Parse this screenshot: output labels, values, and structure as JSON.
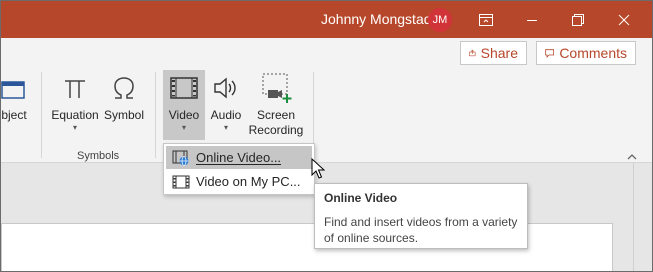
{
  "titlebar": {
    "user_name": "Johnny Mongstad",
    "avatar_initials": "JM",
    "accent": "#b7472a"
  },
  "actions": {
    "share_label": "Share",
    "comments_label": "Comments"
  },
  "ribbon": {
    "object_label_partial": "bject",
    "equation_label": "Equation",
    "symbol_label": "Symbol",
    "symbols_group_label": "Symbols",
    "video_label": "Video",
    "audio_label": "Audio",
    "screen_recording_line1": "Screen",
    "screen_recording_line2": "Recording"
  },
  "menu": {
    "items": [
      {
        "label": "Online Video...",
        "icon": "online-video-icon",
        "state": "hover"
      },
      {
        "label": "Video on My PC...",
        "icon": "film-icon",
        "state": "normal"
      }
    ]
  },
  "tooltip": {
    "title": "Online Video",
    "description_line1": "Find and insert videos from a variety",
    "description_line2": "of online sources."
  }
}
